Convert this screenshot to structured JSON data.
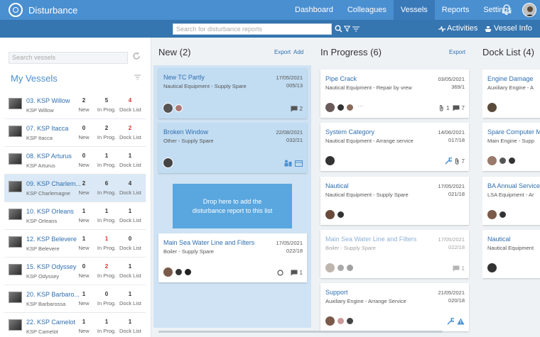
{
  "app": {
    "title": "Disturbance"
  },
  "nav": {
    "items": [
      "Dashboard",
      "Colleagues",
      "Vessels",
      "Reports",
      "Settings"
    ],
    "active": "Vessels"
  },
  "subbar": {
    "search_placeholder": "Search for disturbance reports",
    "activities": "Activities",
    "vessel_info": "Vessel Info"
  },
  "sidebar": {
    "search_placeholder": "Search vessels",
    "heading": "My Vessels",
    "vessels": [
      {
        "name": "03. KSP Willow",
        "sub": "KSP Willow",
        "new": "2",
        "inprog": "5",
        "dock": "4"
      },
      {
        "name": "07. KSP Itacca",
        "sub": "KSP Itacca",
        "new": "0",
        "inprog": "2",
        "dock": "2"
      },
      {
        "name": "08. KSP Arturus",
        "sub": "KSP Arturus",
        "new": "0",
        "inprog": "1",
        "dock": "1"
      },
      {
        "name": "09. KSP Charlem...",
        "sub": "KSP Charlemagne",
        "new": "2",
        "inprog": "6",
        "dock": "4"
      },
      {
        "name": "10. KSP Orleans",
        "sub": "KSP Orleans",
        "new": "1",
        "inprog": "1",
        "dock": "1"
      },
      {
        "name": "12. KSP Belevere",
        "sub": "KSP Belevere",
        "new": "1",
        "inprog": "1",
        "dock": "0"
      },
      {
        "name": "15. KSP Odyssey",
        "sub": "KSP Odyssey",
        "new": "0",
        "inprog": "2",
        "dock": "1"
      },
      {
        "name": "20. KSP Barbaro...",
        "sub": "KSP Barbarossa",
        "new": "1",
        "inprog": "0",
        "dock": "1"
      },
      {
        "name": "22. KSP Camelot",
        "sub": "KSP Camelot",
        "new": "1",
        "inprog": "1",
        "dock": "1"
      }
    ],
    "labels": {
      "new": "New",
      "inprog": "In Prog.",
      "dock": "Dock List"
    }
  },
  "columns": {
    "new": {
      "title": "New (2)",
      "export": "Export",
      "add": "Add"
    },
    "inprogress": {
      "title": "In Progress (6)",
      "export": "Export"
    },
    "docklist": {
      "title": "Dock List (4)"
    }
  },
  "new_cards": [
    {
      "title": "New TC Partly",
      "sub": "Nautical Equipment - Supply Spare",
      "date": "17/05/2021",
      "id": "005/13",
      "comments": "2"
    },
    {
      "title": "Broken Window",
      "sub": "Other - Supply Spare",
      "date": "22/08/2021",
      "id": "032/21"
    },
    {
      "title": "Main Sea Water Line and Filters",
      "sub": "Boiler - Supply Spare",
      "date": "17/05/2021",
      "id": "022/18",
      "comments": "1"
    }
  ],
  "dropzone": {
    "line1": "Drop here to add the",
    "line2": "disturbance report to this list"
  },
  "inprogress_cards": [
    {
      "title": "Pipe Crack",
      "sub": "Nautical Equipment - Repair by vrew",
      "date": "03/05/2021",
      "id": "369/1",
      "attachments": "1",
      "comments": "7"
    },
    {
      "title": "System Category",
      "sub": "Nautical Equipment - Arrange service",
      "date": "14/06/2021",
      "id": "017/18",
      "attachments": "7"
    },
    {
      "title": "Nautical",
      "sub": "Nautical Equipment - Supply Spare",
      "date": "17/05/2021",
      "id": "021/18"
    },
    {
      "title": "Main Sea Water Line and Filters",
      "sub": "Boiler - Supply Spare",
      "date": "17/05/2021",
      "id": "022/18",
      "comments": "1"
    },
    {
      "title": "Support",
      "sub": "Auxiliary Engine - Arrange Service",
      "date": "21/05/2021",
      "id": "020/18"
    }
  ],
  "dock_cards": [
    {
      "title": "Engine Damage",
      "sub": "Auxiliary Engine - A"
    },
    {
      "title": "Spare Computer M",
      "sub": "Main Engine - Supp"
    },
    {
      "title": "BA Annual Service",
      "sub": "LSA Equipment - Ar"
    },
    {
      "title": "Nautical",
      "sub": "Nautical Equipment"
    }
  ],
  "colors": {
    "accent": "#4a8fd0",
    "nav_active": "#3a79b8",
    "subbar": "#3575b0",
    "red": "#d33333",
    "new_column": "#cfe3f4"
  }
}
